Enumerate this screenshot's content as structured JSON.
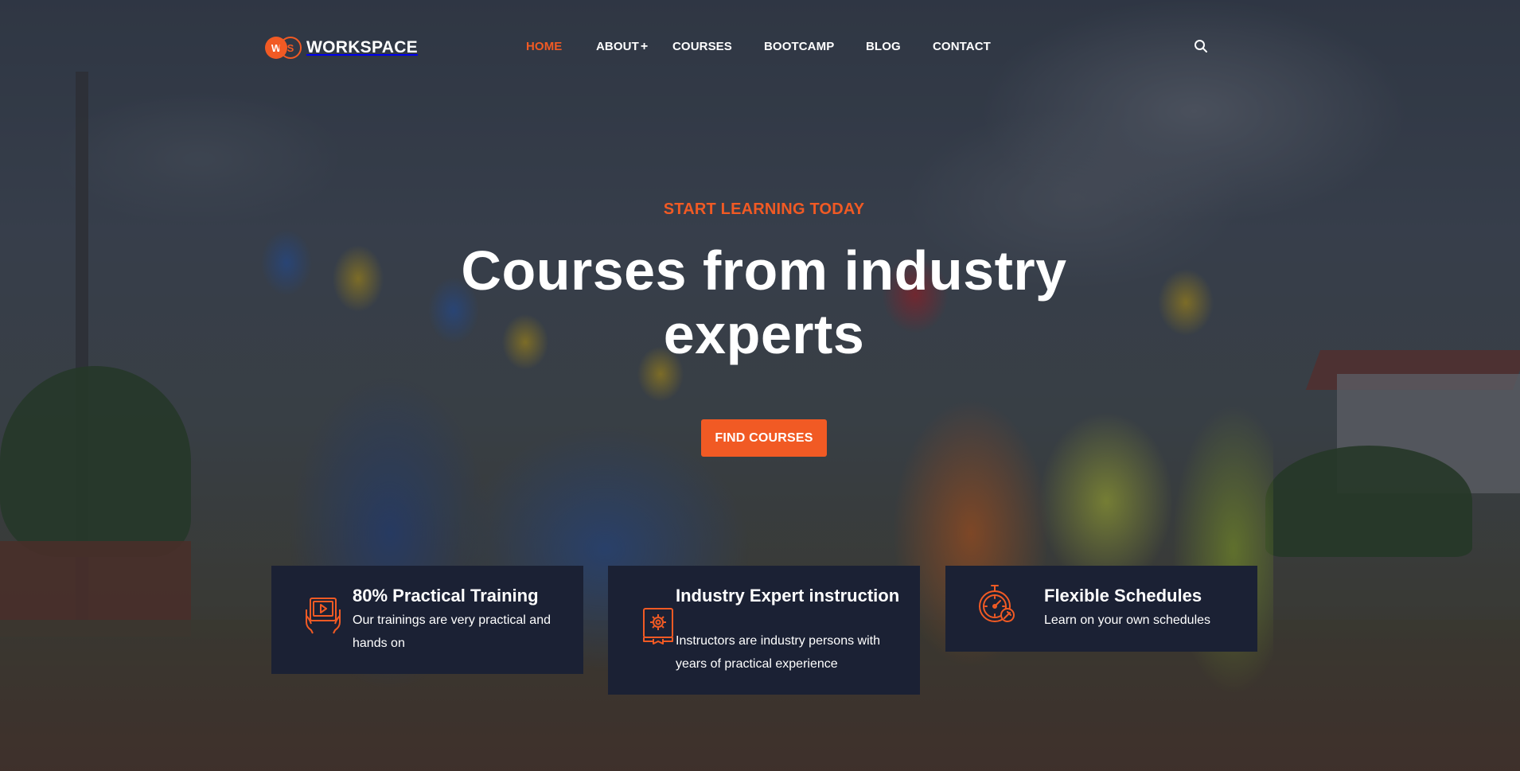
{
  "brand": {
    "logo_initials": [
      "W",
      "S"
    ],
    "name": "WORKSPACE",
    "accent_color": "#f15a24",
    "card_color": "#1b2134"
  },
  "nav": {
    "items": [
      {
        "label": "HOME",
        "active": true
      },
      {
        "label": "ABOUT",
        "suffix": "+"
      },
      {
        "label": "COURSES"
      },
      {
        "label": "BOOTCAMP"
      },
      {
        "label": "BLOG"
      },
      {
        "label": "CONTACT"
      }
    ],
    "search_icon": "search-icon"
  },
  "hero": {
    "eyebrow": "START LEARNING TODAY",
    "headline": "Courses from industry experts",
    "cta_label": "FIND COURSES"
  },
  "features": [
    {
      "icon": "video-tablet-icon",
      "title": "80% Practical Training",
      "description": "Our trainings are very practical and hands on"
    },
    {
      "icon": "certificate-gear-icon",
      "title": "Industry Expert instruction",
      "description": "Instructors are industry persons with years of practical experience"
    },
    {
      "icon": "stopwatch-icon",
      "title": "Flexible Schedules",
      "description": "Learn on your own schedules"
    }
  ]
}
